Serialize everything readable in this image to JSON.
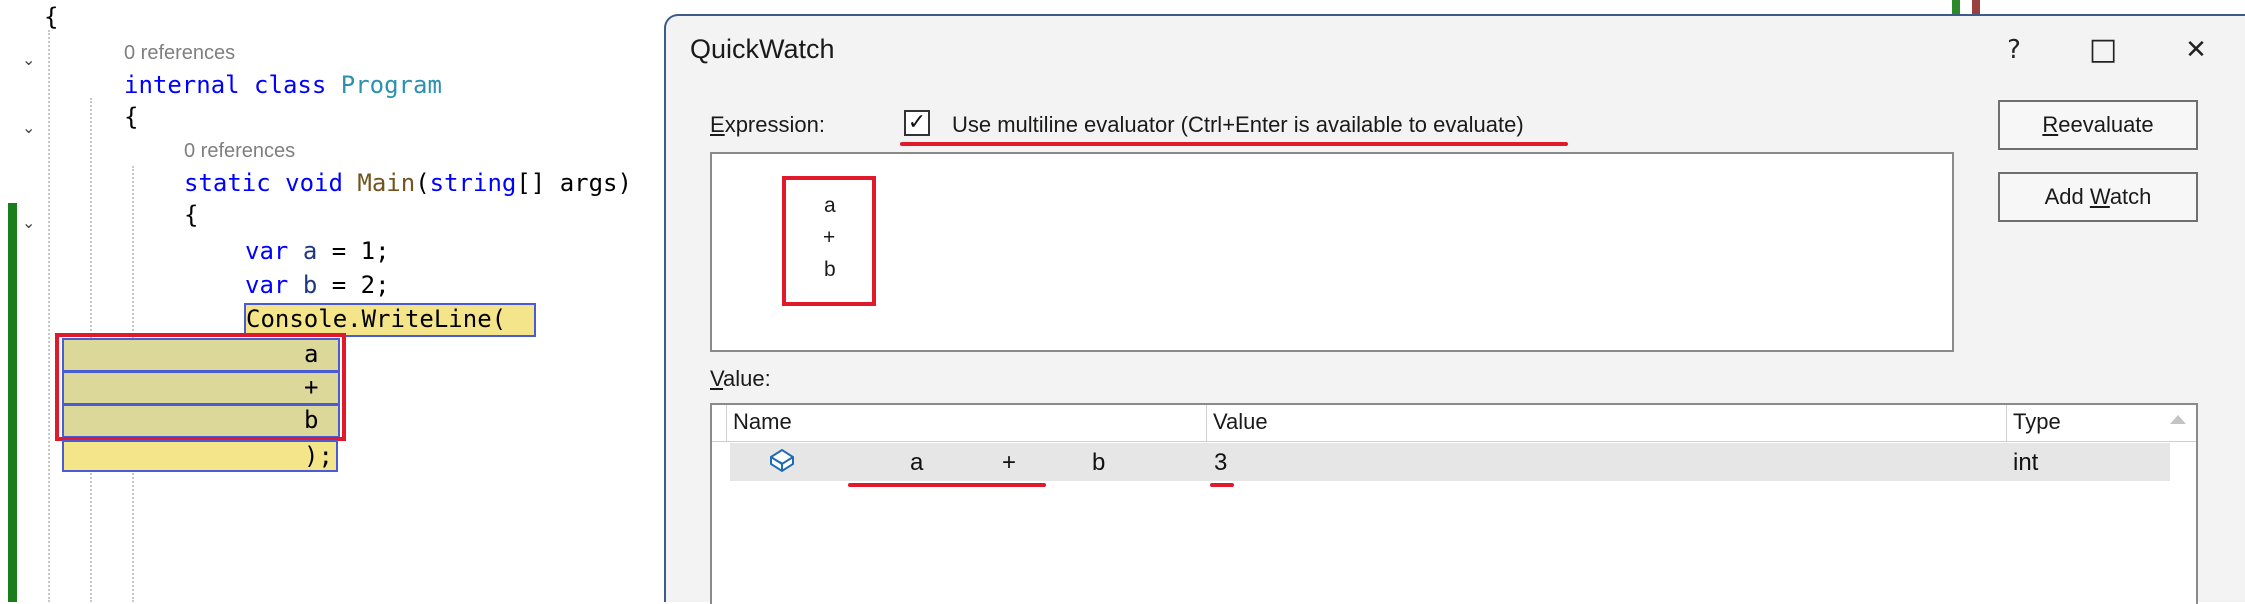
{
  "editor": {
    "refs_class": "0 references",
    "refs_method": "0 references",
    "line_open_brace_top": "{",
    "class_kw": "internal class",
    "class_name": "Program",
    "class_open": "{",
    "method_kw": "static void",
    "method_name": "Main",
    "method_param_type": "string",
    "method_params_rest": "[] args)",
    "method_args": "args",
    "method_open": "{",
    "var_kw": "var",
    "var_a": "a",
    "var_a_rest": " = 1;",
    "var_b": "b",
    "var_b_rest": " = 2;",
    "console_call": "Console.WriteLine(",
    "expr_a": "a",
    "expr_plus": "+",
    "expr_b": "b",
    "close_call": ");"
  },
  "dialog": {
    "title": "QuickWatch",
    "help_icon": "?",
    "maximize_icon": "□",
    "close_icon": "✕",
    "expression_label_underlined": "E",
    "expression_label_rest": "xpression:",
    "multiline_checked": true,
    "multiline_check_glyph": "✓",
    "multiline_label": "Use multiline evaluator (Ctrl+Enter is available to evaluate)",
    "expression_lines": [
      "a",
      "+",
      "b"
    ],
    "reevaluate_underlined": "R",
    "reevaluate_rest": "eevaluate",
    "addwatch_pre": "Add ",
    "addwatch_underlined": "W",
    "addwatch_rest": "atch",
    "value_label_underlined": "V",
    "value_label_rest": "alue:",
    "columns": [
      "Name",
      "Value",
      "Type"
    ],
    "rows": [
      {
        "name_parts": [
          "a",
          "+",
          "b"
        ],
        "value": "3",
        "type": "int",
        "icon": "field-icon"
      }
    ]
  },
  "colors": {
    "accent_red": "#e0192b",
    "highlight_yellow": "#f4e58a",
    "highlight_border": "#4b5bd6",
    "keyword_blue": "#0000ff",
    "type_teal": "#2b91af",
    "change_bar_green": "#1a7f1a"
  }
}
